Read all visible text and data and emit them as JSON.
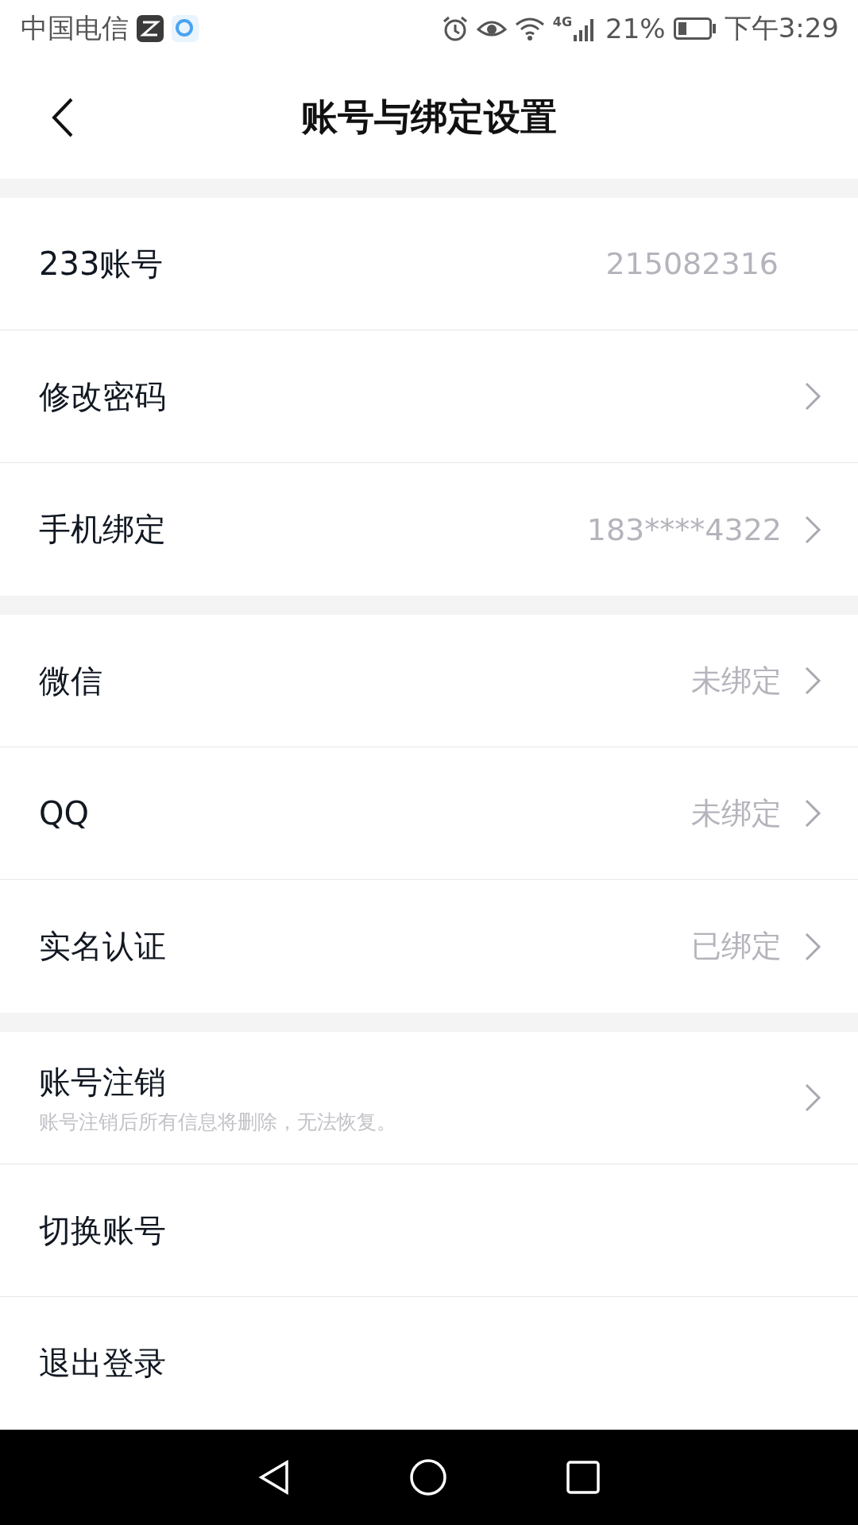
{
  "status_bar": {
    "carrier": "中国电信",
    "network": "4G",
    "battery_percent": "21%",
    "time": "下午3:29"
  },
  "header": {
    "title": "账号与绑定设置"
  },
  "sections": [
    {
      "rows": [
        {
          "label": "233账号",
          "value": "215082316",
          "chevron": false
        },
        {
          "label": "修改密码",
          "chevron": true
        },
        {
          "label": "手机绑定",
          "value": "183****4322",
          "chevron": true
        }
      ]
    },
    {
      "rows": [
        {
          "label": "微信",
          "value": "未绑定",
          "chevron": true
        },
        {
          "label": "QQ",
          "value": "未绑定",
          "chevron": true
        },
        {
          "label": "实名认证",
          "value": "已绑定",
          "chevron": true
        }
      ]
    },
    {
      "rows": [
        {
          "label": "账号注销",
          "subtitle": "账号注销后所有信息将删除，无法恢复。",
          "chevron": true
        },
        {
          "label": "切换账号",
          "chevron": false
        },
        {
          "label": "退出登录",
          "chevron": false
        }
      ]
    }
  ]
}
